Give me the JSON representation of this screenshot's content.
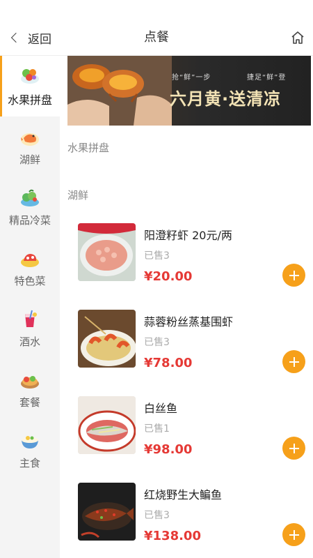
{
  "header": {
    "back_label": "返回",
    "title": "点餐"
  },
  "sidebar": {
    "items": [
      {
        "label": "水果拼盘",
        "icon": "fruit-platter-icon"
      },
      {
        "label": "湖鲜",
        "icon": "lake-fresh-icon"
      },
      {
        "label": "精品冷菜",
        "icon": "cold-dish-icon"
      },
      {
        "label": "特色菜",
        "icon": "special-dish-icon"
      },
      {
        "label": "酒水",
        "icon": "drink-icon"
      },
      {
        "label": "套餐",
        "icon": "set-meal-icon"
      },
      {
        "label": "主食",
        "icon": "staple-food-icon"
      }
    ],
    "active_index": 0
  },
  "banner": {
    "small_left": "抢“鲜”一步",
    "small_right": "捷足“鲜”登",
    "main": "六月黄·送清凉"
  },
  "sections": [
    {
      "title": "水果拼盘",
      "items": []
    },
    {
      "title": "湖鲜",
      "items": [
        {
          "name": "阳澄籽虾 20元/两",
          "sold": "已售3",
          "price": "¥20.00"
        },
        {
          "name": "蒜蓉粉丝蒸基围虾",
          "sold": "已售3",
          "price": "¥78.00"
        },
        {
          "name": "白丝鱼",
          "sold": "已售1",
          "price": "¥98.00"
        },
        {
          "name": "红烧野生大鳊鱼",
          "sold": "已售3",
          "price": "¥138.00"
        }
      ]
    }
  ],
  "colors": {
    "accent": "#f6a01a",
    "price": "#e53935",
    "sidebar_bg": "#f4f4f4"
  }
}
